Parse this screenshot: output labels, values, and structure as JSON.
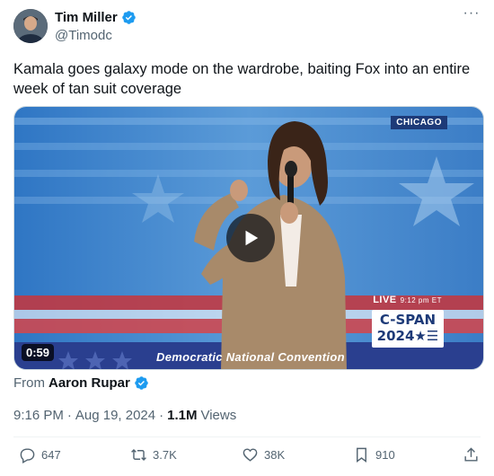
{
  "author": {
    "display_name": "Tim Miller",
    "handle": "@Timodc",
    "verified": true
  },
  "menu": {
    "more_icon": "more-horizontal-icon",
    "more_label": "···"
  },
  "tweet": {
    "text": "Kamala goes galaxy mode on the wardrobe, baiting Fox into an entire week of tan suit coverage"
  },
  "video": {
    "location_badge": "CHICAGO",
    "live_label": "LIVE",
    "live_time": "9:12 pm ET",
    "network_line1": "C-SPAN",
    "network_line2": "2024★☰",
    "banner": "Democratic National Convention",
    "duration": "0:59",
    "play_icon": "play-icon"
  },
  "attribution": {
    "from_label": "From",
    "from_name": "Aaron Rupar",
    "verified": true
  },
  "meta": {
    "time": "9:16 PM",
    "separator": "·",
    "date": "Aug 19, 2024",
    "views_count": "1.1M",
    "views_label": "Views"
  },
  "actions": {
    "replies": "647",
    "reposts": "3.7K",
    "likes": "38K",
    "bookmarks": "910"
  },
  "colors": {
    "text_primary": "#0f1419",
    "text_secondary": "#536471",
    "verified_blue": "#1d9bf0",
    "divider": "#eff3f4"
  }
}
